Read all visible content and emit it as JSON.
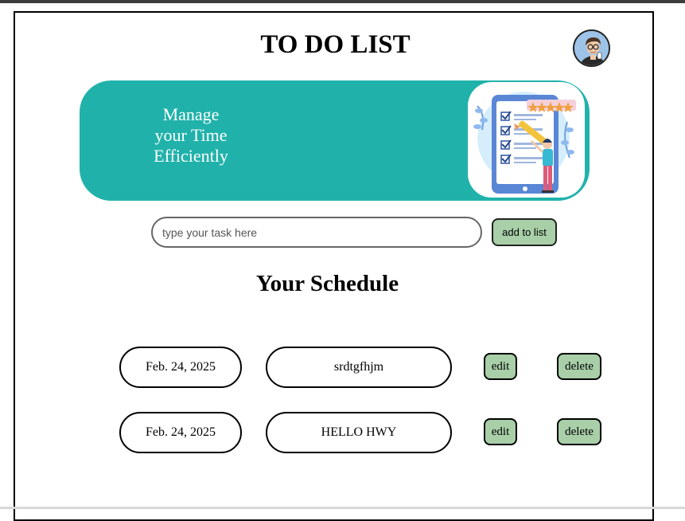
{
  "header": {
    "title": "TO DO LIST",
    "avatar_icon": "user-avatar"
  },
  "banner": {
    "line1": "Manage",
    "line2": "your Time",
    "line3": "Efficiently",
    "bg_color": "#20b2aa",
    "art_icon": "checklist-illustration"
  },
  "form": {
    "input_placeholder": "type your task here",
    "input_value": "",
    "add_label": "add to list"
  },
  "schedule": {
    "title": "Your Schedule",
    "items": [
      {
        "date": "Feb. 24, 2025",
        "task": "srdtgfhjm",
        "edit_label": "edit",
        "delete_label": "delete"
      },
      {
        "date": "Feb. 24, 2025",
        "task": "HELLO HWY",
        "edit_label": "edit",
        "delete_label": "delete"
      }
    ]
  },
  "colors": {
    "accent": "#20b2aa",
    "button_bg": "#a8cfa8"
  }
}
